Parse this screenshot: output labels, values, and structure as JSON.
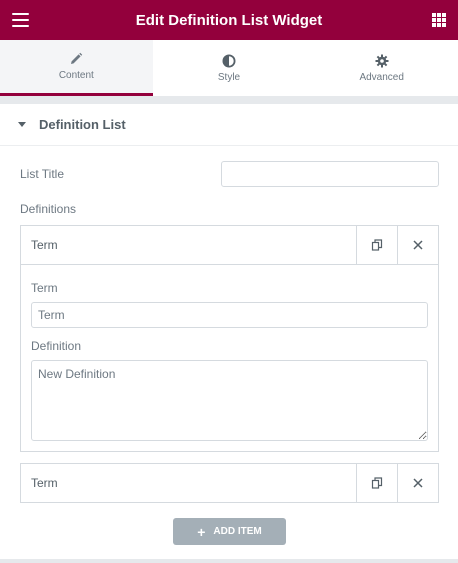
{
  "header": {
    "title": "Edit Definition List Widget",
    "menu_icon": "hamburger-menu-icon",
    "apps_icon": "grid-apps-icon",
    "bg_color": "#93003c"
  },
  "tabs": [
    {
      "label": "Content",
      "icon": "pencil-icon",
      "active": true
    },
    {
      "label": "Style",
      "icon": "half-circle-icon",
      "active": false
    },
    {
      "label": "Advanced",
      "icon": "gear-icon",
      "active": false
    }
  ],
  "section": {
    "title": "Definition List",
    "expanded": true
  },
  "fields": {
    "list_title_label": "List Title",
    "list_title_value": "",
    "definitions_label": "Definitions"
  },
  "items": [
    {
      "title": "Term",
      "expanded": true,
      "term_label": "Term",
      "term_value": "Term",
      "definition_label": "Definition",
      "definition_value": "New Definition"
    },
    {
      "title": "Term",
      "expanded": false
    }
  ],
  "add_button": {
    "icon": "plus-icon",
    "label": "ADD ITEM"
  }
}
